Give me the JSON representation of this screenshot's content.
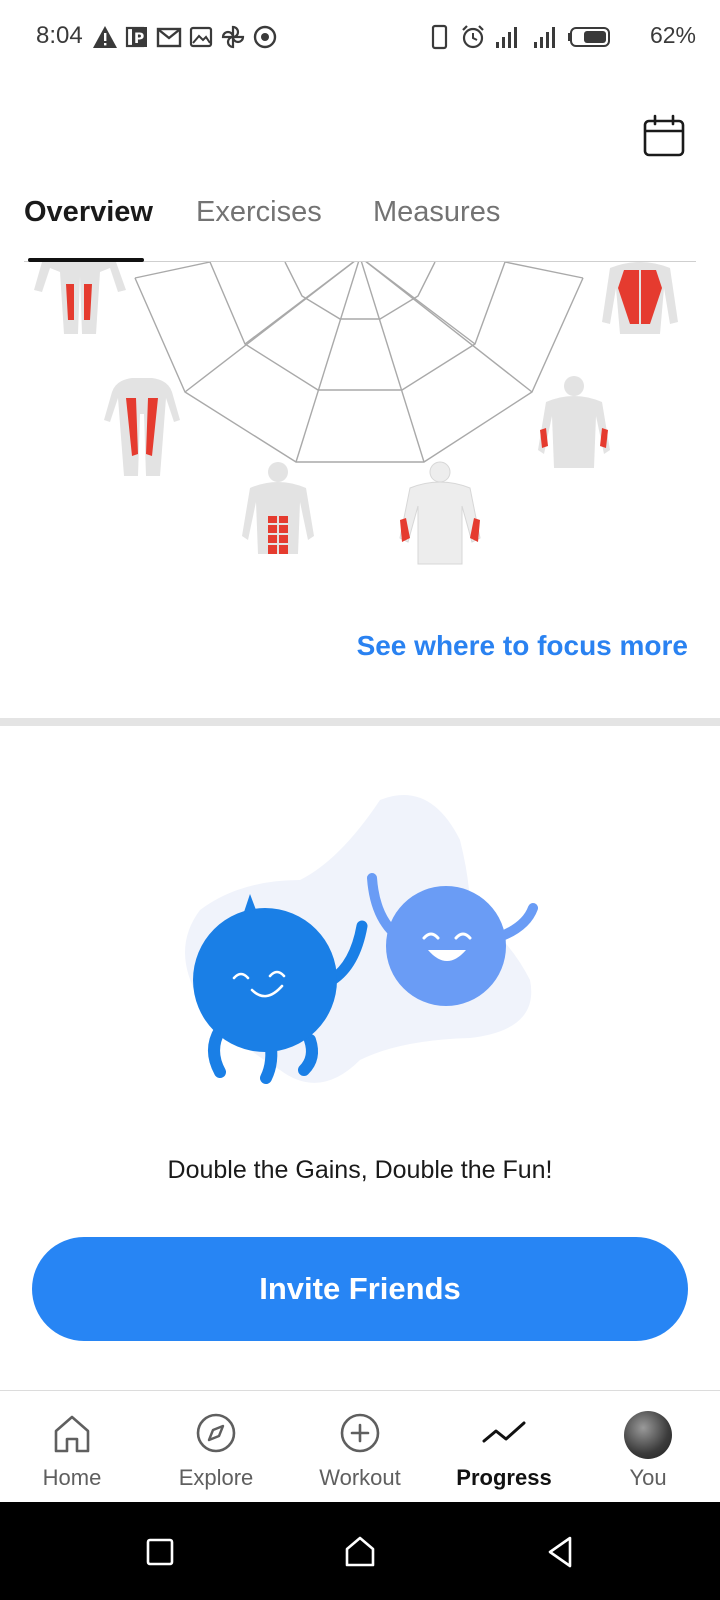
{
  "status_bar": {
    "time": "8:04",
    "battery": "62%"
  },
  "tabs": [
    {
      "label": "Overview",
      "active": true
    },
    {
      "label": "Exercises",
      "active": false
    },
    {
      "label": "Measures",
      "active": false
    }
  ],
  "overview": {
    "focus_link": "See where to focus more"
  },
  "invite": {
    "tagline": "Double the Gains, Double the Fun!",
    "button_label": "Invite Friends"
  },
  "bottom_nav": [
    {
      "label": "Home",
      "icon": "home-icon",
      "active": false
    },
    {
      "label": "Explore",
      "icon": "compass-icon",
      "active": false
    },
    {
      "label": "Workout",
      "icon": "plus-circle-icon",
      "active": false
    },
    {
      "label": "Progress",
      "icon": "trend-icon",
      "active": true
    },
    {
      "label": "You",
      "icon": "avatar",
      "active": false
    }
  ],
  "colors": {
    "accent": "#2785f4",
    "muscle_highlight": "#e53b2f",
    "character_dark": "#1a7fe6",
    "character_light": "#6a9cf5"
  }
}
